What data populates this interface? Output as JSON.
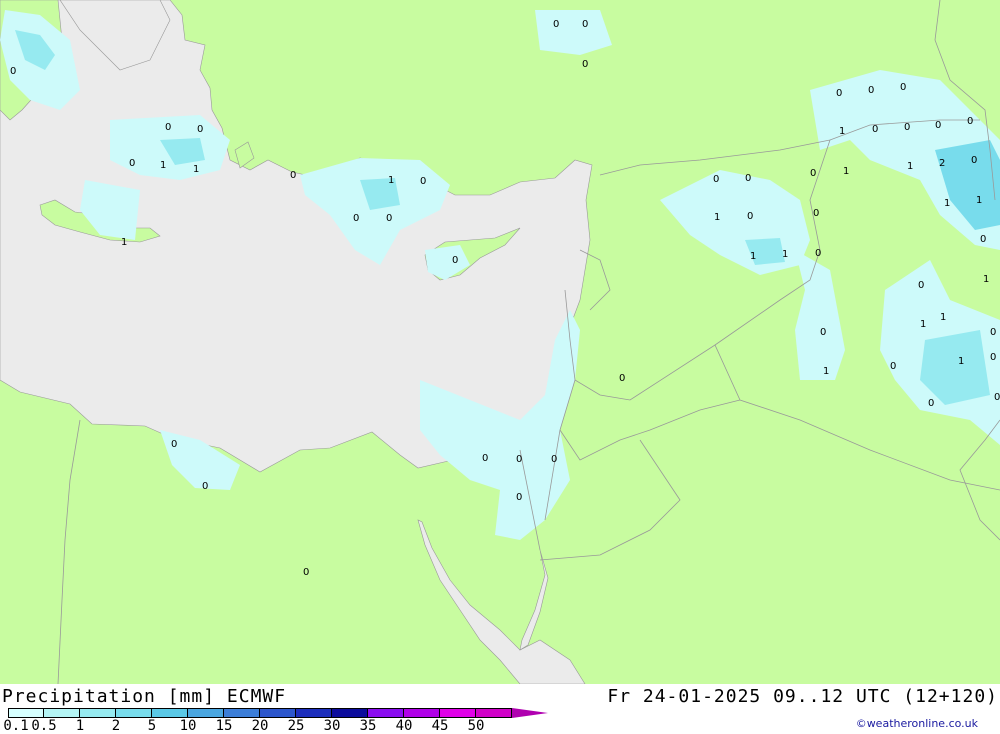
{
  "footer": {
    "title": "Precipitation [mm] ECMWF",
    "time": "Fr 24-01-2025 09..12 UTC (12+120)",
    "credit": "©weatheronline.co.uk"
  },
  "legend": {
    "ticks": [
      "0.1",
      "0.5",
      "1",
      "2",
      "5",
      "10",
      "15",
      "20",
      "25",
      "30",
      "35",
      "40",
      "45",
      "50"
    ],
    "colors": [
      "#d6ffff",
      "#b4f5f5",
      "#96eaf0",
      "#78dcec",
      "#5ac8e6",
      "#4aa6e0",
      "#3c7ed8",
      "#2c56cc",
      "#1c2ebc",
      "#0c0c9c",
      "#8a0cf0",
      "#b000e8",
      "#e000e8",
      "#d000c8"
    ],
    "arrow_color": "#b000b0"
  },
  "map_colors": {
    "land": "#c8fca0",
    "sea": "#ebebeb",
    "precip_light": "#cdfafa",
    "precip_mid": "#a8eef2",
    "precip_strong": "#78d8ea",
    "border": "#999999"
  },
  "values": [
    {
      "id": "v1",
      "text": "0"
    },
    {
      "id": "v2",
      "text": "0"
    },
    {
      "id": "v3",
      "text": "0"
    },
    {
      "id": "v4",
      "text": "0"
    },
    {
      "id": "v5",
      "text": "0"
    },
    {
      "id": "v6",
      "text": "0"
    },
    {
      "id": "v7",
      "text": "0"
    },
    {
      "id": "v8",
      "text": "1"
    },
    {
      "id": "v9",
      "text": "1"
    },
    {
      "id": "v10",
      "text": "1"
    },
    {
      "id": "v11",
      "text": "0"
    },
    {
      "id": "v12",
      "text": "1"
    },
    {
      "id": "v13",
      "text": "0"
    },
    {
      "id": "v14",
      "text": "0"
    },
    {
      "id": "v15",
      "text": "0"
    },
    {
      "id": "v16",
      "text": "0"
    },
    {
      "id": "v17",
      "text": "0"
    },
    {
      "id": "v18",
      "text": "0"
    },
    {
      "id": "v19",
      "text": "0"
    },
    {
      "id": "v20",
      "text": "0"
    },
    {
      "id": "v21",
      "text": "0"
    },
    {
      "id": "v22",
      "text": "0"
    },
    {
      "id": "v23",
      "text": "0"
    },
    {
      "id": "v24",
      "text": "0"
    },
    {
      "id": "v25",
      "text": "0"
    },
    {
      "id": "v26",
      "text": "0"
    },
    {
      "id": "v27",
      "text": "1"
    },
    {
      "id": "v28",
      "text": "0"
    },
    {
      "id": "v29",
      "text": "1"
    },
    {
      "id": "v30",
      "text": "1"
    },
    {
      "id": "v31",
      "text": "0"
    },
    {
      "id": "v32",
      "text": "0"
    },
    {
      "id": "v33",
      "text": "0"
    },
    {
      "id": "v34",
      "text": "0"
    },
    {
      "id": "v35",
      "text": "1"
    },
    {
      "id": "v36",
      "text": "0"
    },
    {
      "id": "v37",
      "text": "0"
    },
    {
      "id": "v38",
      "text": "0"
    },
    {
      "id": "v39",
      "text": "0"
    },
    {
      "id": "v40",
      "text": "1"
    },
    {
      "id": "v41",
      "text": "0"
    },
    {
      "id": "v42",
      "text": "0"
    },
    {
      "id": "v43",
      "text": "1"
    },
    {
      "id": "v44",
      "text": "2"
    },
    {
      "id": "v45",
      "text": "0"
    },
    {
      "id": "v46",
      "text": "1"
    },
    {
      "id": "v47",
      "text": "1"
    },
    {
      "id": "v48",
      "text": "0"
    },
    {
      "id": "v49",
      "text": "0"
    },
    {
      "id": "v50",
      "text": "1"
    },
    {
      "id": "v51",
      "text": "1"
    },
    {
      "id": "v52",
      "text": "0"
    },
    {
      "id": "v53",
      "text": "1"
    },
    {
      "id": "v54",
      "text": "0"
    },
    {
      "id": "v55",
      "text": "1"
    },
    {
      "id": "v56",
      "text": "0"
    },
    {
      "id": "v57",
      "text": "0"
    },
    {
      "id": "v58",
      "text": "0"
    },
    {
      "id": "v59",
      "text": "0"
    },
    {
      "id": "v60",
      "text": "1"
    }
  ]
}
